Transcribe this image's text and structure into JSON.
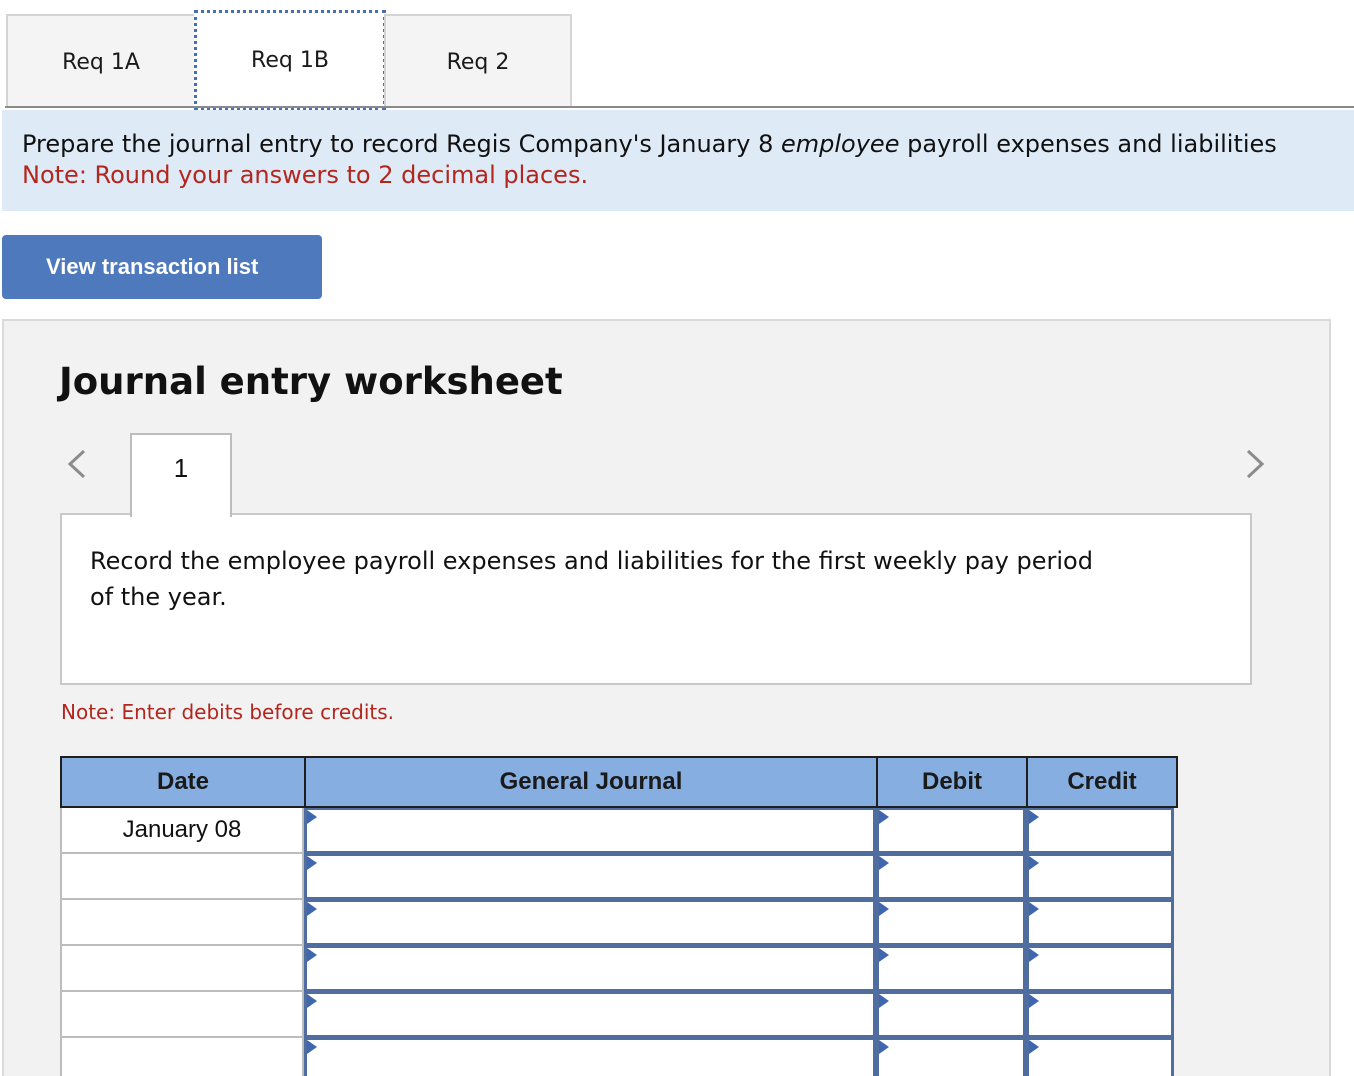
{
  "tabs": [
    {
      "label": "Req 1A",
      "active": false
    },
    {
      "label": "Req 1B",
      "active": true
    },
    {
      "label": "Req 2",
      "active": false
    }
  ],
  "instructions": {
    "line1_before": "Prepare the journal entry to record Regis Company's January 8 ",
    "line1_emphasis": "employee",
    "line1_after": " payroll expenses and liabilities",
    "note": "Note: Round your answers to 2 decimal places."
  },
  "view_button_label": "View transaction list",
  "worksheet": {
    "title": "Journal entry worksheet",
    "entry_tab_label": "1",
    "description": "Record the employee payroll expenses and liabilities for the first weekly pay period of the year.",
    "note": "Note: Enter debits before credits."
  },
  "journal": {
    "headers": {
      "date": "Date",
      "account": "General Journal",
      "debit": "Debit",
      "credit": "Credit"
    },
    "rows": [
      {
        "date": "January 08",
        "account": "",
        "debit": "",
        "credit": ""
      },
      {
        "date": "",
        "account": "",
        "debit": "",
        "credit": ""
      },
      {
        "date": "",
        "account": "",
        "debit": "",
        "credit": ""
      },
      {
        "date": "",
        "account": "",
        "debit": "",
        "credit": ""
      },
      {
        "date": "",
        "account": "",
        "debit": "",
        "credit": ""
      },
      {
        "date": "",
        "account": "",
        "debit": "",
        "credit": ""
      }
    ]
  },
  "icons": {
    "prev": "chevron-left-icon",
    "next": "chevron-right-icon",
    "cell_marker": "dropdown-triangle-icon"
  },
  "colors": {
    "active_tab_border": "#4a6fb0",
    "banner_bg": "#deebf7",
    "note_red": "#b3261e",
    "button_blue": "#4e79bc",
    "table_header_bg": "#86aee0",
    "input_border": "#4f6d9e"
  }
}
